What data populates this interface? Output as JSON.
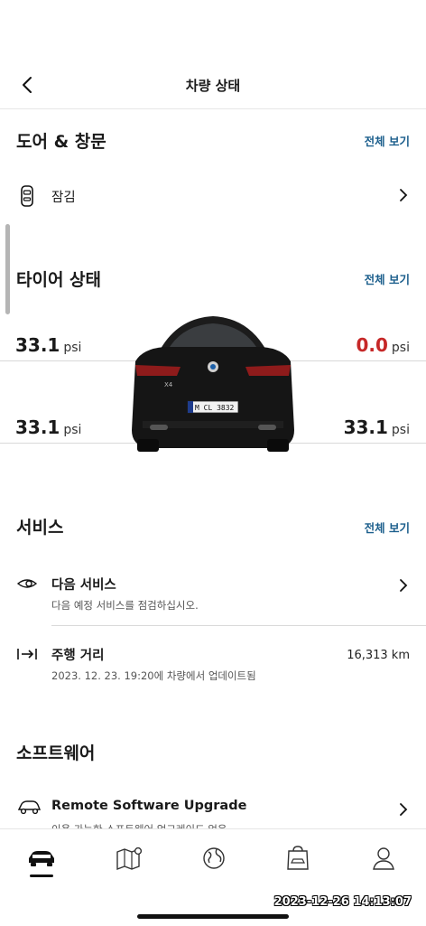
{
  "header": {
    "title": "차량 상태"
  },
  "doors": {
    "title": "도어 & 창문",
    "view_all": "전체 보기",
    "lock_status": "잠김"
  },
  "tires": {
    "title": "타이어 상태",
    "view_all": "전체 보기",
    "unit": "psi",
    "front_left": "33.1",
    "front_right": "0.0",
    "rear_left": "33.1",
    "rear_right": "33.1",
    "warning_color": "#c62828",
    "plate": "M CL 3832",
    "badge": "X4"
  },
  "service": {
    "title": "서비스",
    "view_all": "전체 보기",
    "next_service_title": "다음 서비스",
    "next_service_sub": "다음 예정 서비스를 점검하십시오.",
    "mileage_title": "주행 거리",
    "mileage_sub": "2023. 12. 23. 19:20에 차량에서 업데이트됨",
    "mileage_value": "16,313 km"
  },
  "software": {
    "title": "소프트웨어",
    "upgrade_title": "Remote Software Upgrade",
    "upgrade_sub": "이용 가능한 소프트웨어 업그레이드 없음"
  },
  "tabbar": {
    "items": [
      "car-icon",
      "map-icon",
      "globe-icon",
      "shop-icon",
      "profile-icon"
    ],
    "active": 0
  },
  "overlay": {
    "timestamp": "2023-12-26 14:13:07"
  }
}
